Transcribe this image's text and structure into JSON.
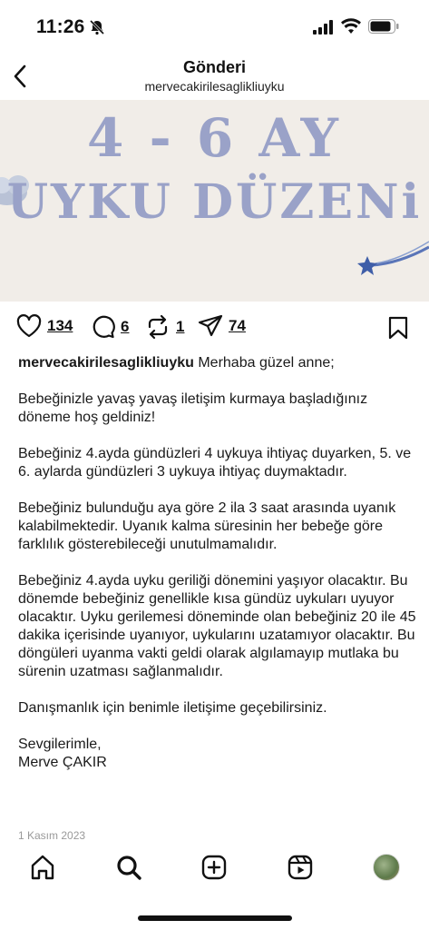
{
  "status_bar": {
    "time": "11:26"
  },
  "header": {
    "title": "Gönderi",
    "username": "mervecakirilesaglikliuyku"
  },
  "post_image": {
    "line1": "4 - 6 AY",
    "line2": "UYKU DÜZENi"
  },
  "actions": {
    "likes": "134",
    "comments": "6",
    "reposts": "1",
    "shares": "74"
  },
  "caption": {
    "username": "mervecakirilesaglikliuyku",
    "first_line": " Merhaba güzel anne;",
    "paragraphs": [
      "Bebeğinizle yavaş yavaş iletişim kurmaya başladığınız döneme hoş geldiniz!",
      "Bebeğiniz 4.ayda gündüzleri 4 uykuya ihtiyaç duyarken, 5. ve 6. aylarda gündüzleri 3 uykuya ihtiyaç duymaktadır.",
      "Bebeğiniz bulunduğu aya göre 2 ila 3 saat arasında uyanık kalabilmektedir. Uyanık kalma süresinin her bebeğe göre farklılık gösterebileceği unutulmamalıdır.",
      "Bebeğiniz 4.ayda uyku geriliği dönemini yaşıyor olacaktır. Bu dönemde bebeğiniz genellikle kısa gündüz uykuları uyuyor olacaktır. Uyku gerilemesi döneminde olan bebeğiniz 20 ile 45 dakika içerisinde uyanıyor, uykularını uzatamıyor olacaktır. Bu döngüleri uyanma vakti geldi olarak algılamayıp mutlaka bu sürenin uzatması sağlanmalıdır.",
      "Danışmanlık için benimle iletişime geçebilirsiniz."
    ],
    "sign_off_1": "Sevgilerimle,",
    "sign_off_2": "Merve ÇAKIR"
  },
  "post_date": "1 Kasım 2023",
  "colors": {
    "image_bg": "#f1ede8",
    "image_text": "#9aa2c8"
  }
}
